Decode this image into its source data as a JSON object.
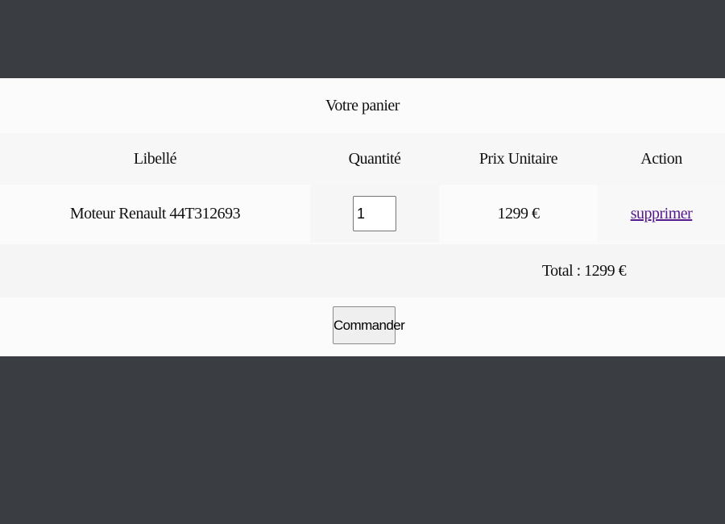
{
  "cart": {
    "title": "Votre panier",
    "columns": {
      "label": "Libellé",
      "quantity": "Quantité",
      "unit_price": "Prix Unitaire",
      "action": "Action"
    },
    "items": [
      {
        "label": "Moteur Renault 44T312693",
        "quantity": "1",
        "unit_price": "1299 €",
        "action": "supprimer"
      }
    ],
    "total": "Total : 1299 €",
    "order_button": "Commander"
  }
}
